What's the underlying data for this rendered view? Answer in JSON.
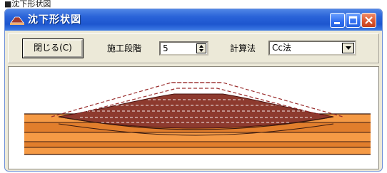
{
  "top_label": "■沈下形状図",
  "window": {
    "title": "沈下形状図"
  },
  "toolbar": {
    "close_button": "閉じる(C)",
    "stage_label": "施工段階",
    "stage_value": "5",
    "method_label": "計算法",
    "method_value": "Cc法"
  },
  "icons": {
    "app": "embankment-icon",
    "minimize": "minimize-icon",
    "maximize": "maximize-icon",
    "close": "close-icon",
    "spin_up": "triangle-up-icon",
    "spin_down": "triangle-down-icon",
    "dropdown": "chevron-down-icon"
  },
  "colors": {
    "titlebar": "#2a63d8",
    "soil_light": "#f59a45",
    "soil_mid": "#e17e2c",
    "embankment": "#8d3a2e",
    "outline_dashed": "#9a2d2d"
  }
}
